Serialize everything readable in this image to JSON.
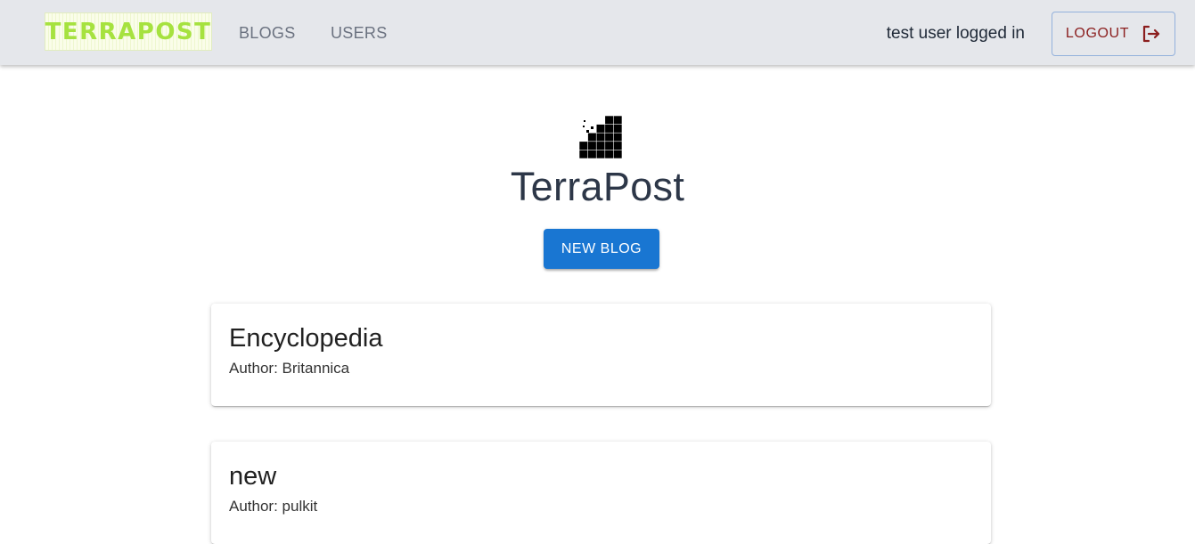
{
  "header": {
    "brand": "TERRAPOST",
    "nav": [
      {
        "label": "BLOGS"
      },
      {
        "label": "USERS"
      }
    ],
    "status": "test user logged in",
    "logout_label": "LOGOUT",
    "logout_icon": "logout-icon"
  },
  "hero": {
    "icon": "pixel-stairs-logo-icon",
    "title": "TerraPost",
    "new_blog_label": "NEW BLOG"
  },
  "blogs": [
    {
      "title": "Encyclopedia",
      "author": "Author: Britannica"
    },
    {
      "title": "new",
      "author": "Author: pulkit"
    }
  ],
  "colors": {
    "appbar": "#e5e7eb",
    "brand": "#a6e23f",
    "primary": "#1976d2",
    "logout": "#8b1e1e"
  }
}
